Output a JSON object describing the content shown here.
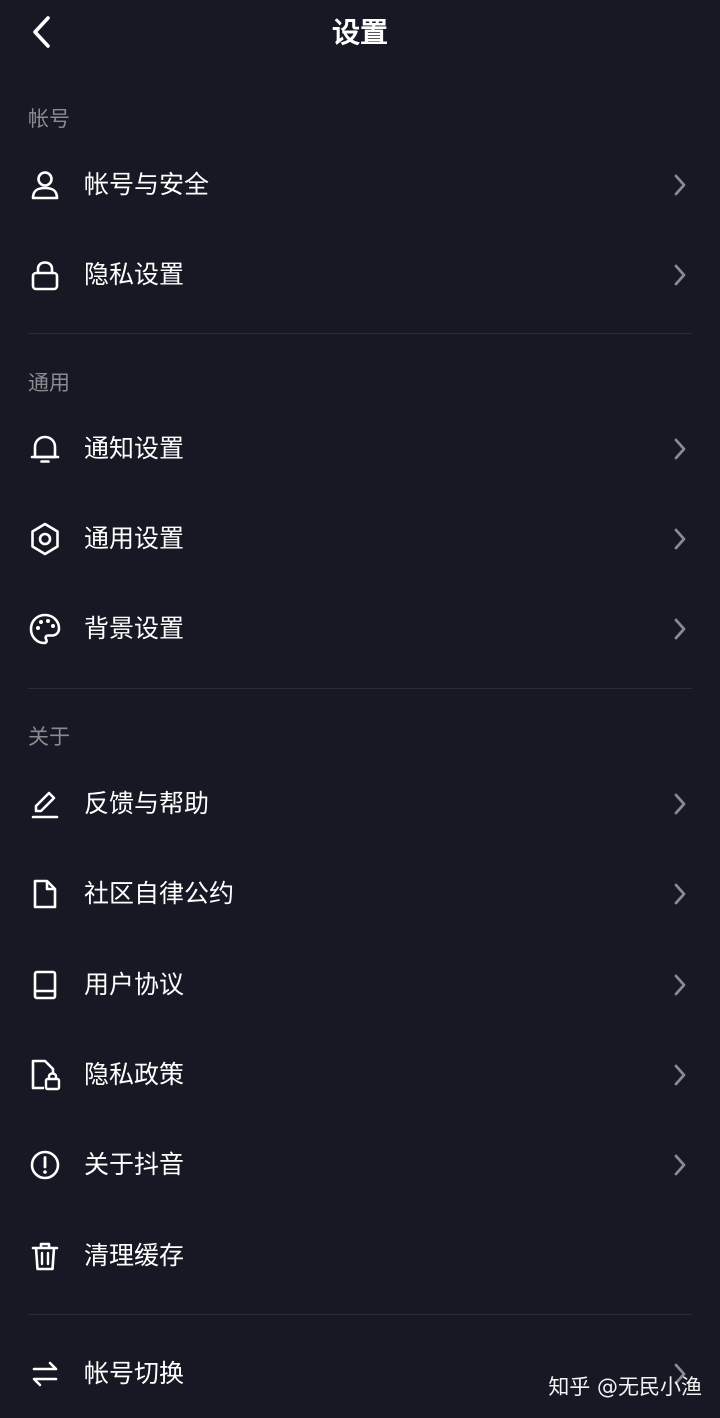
{
  "header": {
    "title": "设置"
  },
  "sections": {
    "account": {
      "title": "帐号",
      "items": [
        {
          "label": "帐号与安全",
          "icon": "user-icon"
        },
        {
          "label": "隐私设置",
          "icon": "lock-icon"
        }
      ]
    },
    "general": {
      "title": "通用",
      "items": [
        {
          "label": "通知设置",
          "icon": "bell-icon"
        },
        {
          "label": "通用设置",
          "icon": "gear-icon"
        },
        {
          "label": "背景设置",
          "icon": "palette-icon"
        }
      ]
    },
    "about": {
      "title": "关于",
      "items": [
        {
          "label": "反馈与帮助",
          "icon": "pencil-icon"
        },
        {
          "label": "社区自律公约",
          "icon": "document-icon"
        },
        {
          "label": "用户协议",
          "icon": "book-icon"
        },
        {
          "label": "隐私政策",
          "icon": "file-lock-icon"
        },
        {
          "label": "关于抖音",
          "icon": "info-icon"
        },
        {
          "label": "清理缓存",
          "icon": "trash-icon"
        }
      ]
    },
    "switch": {
      "items": [
        {
          "label": "帐号切换",
          "icon": "swap-icon"
        }
      ]
    }
  },
  "watermark": "知乎 @无民小渔",
  "colors": {
    "background": "#161823",
    "text": "#ffffff",
    "section_title": "#8a8b91",
    "chevron": "#8a8b91",
    "divider": "#2b2c36"
  }
}
